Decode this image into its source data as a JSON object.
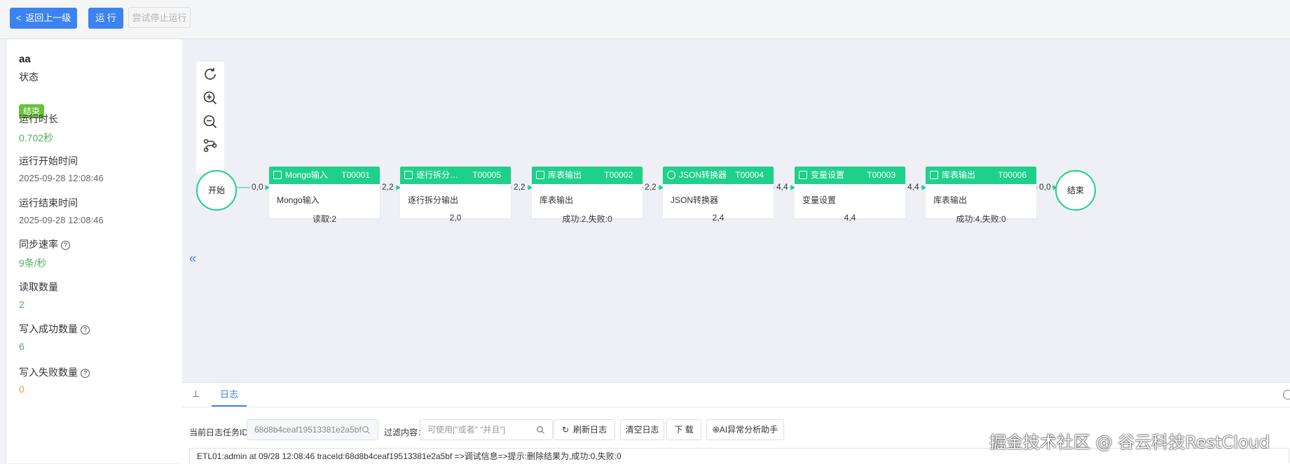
{
  "toolbar": {
    "back_label": "返回上一级",
    "run_label": "运 行",
    "stop_label": "尝试停止运行"
  },
  "summary": {
    "title": "aa",
    "status_label": "状态",
    "status_value": "结束",
    "duration_label": "运行时长",
    "duration_value": "0.702秒",
    "start_label": "运行开始时间",
    "start_value": "2025-09-28 12:08:46",
    "end_label": "运行结束时间",
    "end_value": "2025-09-28 12:08:46",
    "speed_label": "同步速率",
    "speed_value": "9条/秒",
    "read_label": "读取数量",
    "read_value": "2",
    "write_ok_label": "写入成功数量",
    "write_ok_value": "6",
    "write_fail_label": "写入失败数量",
    "write_fail_value": "0"
  },
  "flow": {
    "start_label": "开始",
    "end_label": "结束",
    "nodes": [
      {
        "title": "Mongo输入",
        "code": "T00001",
        "body": "Mongo输入",
        "stat": "读取:2"
      },
      {
        "title": "逐行拆分…",
        "code": "T00005",
        "body": "逐行拆分输出",
        "stat": "2,0"
      },
      {
        "title": "库表输出",
        "code": "T00002",
        "body": "库表输出",
        "stat": "成功:2,失败:0"
      },
      {
        "title": "JSON转换器",
        "code": "T00004",
        "body": "JSON转换器",
        "stat": "2,4"
      },
      {
        "title": "变量设置",
        "code": "T00003",
        "body": "变量设置",
        "stat": "4,4"
      },
      {
        "title": "库表输出",
        "code": "T00006",
        "body": "库表输出",
        "stat": "成功:4,失败:0"
      }
    ],
    "edges": [
      "0,0",
      "2,2",
      "2,2",
      "2,2",
      "4,4",
      "4,4",
      "0,0"
    ]
  },
  "log": {
    "tab_label": "日志",
    "task_id_label": "当前日志任务ID：",
    "task_id_value": "68d8b4ceaf19513381e2a5bf",
    "filter_label": "过滤内容：",
    "filter_placeholder": "可使用[\"或者\" \"并且\"]",
    "refresh_label": "刷新日志",
    "clear_label": "清空日志",
    "download_label": "下 载",
    "ai_label": "AI异常分析助手",
    "line": "ETL01:admin at 09/28 12:08:46 traceId:68d8b4ceaf19513381e2a5bf =>调试信息=>提示:删除结果为,成功:0,失败:0"
  },
  "watermark": "掘金技术社区 @ 谷云科技RestCloud",
  "colors": {
    "primary": "#3c82f0",
    "node_green": "#1fd08a",
    "status_green": "#67c23a"
  }
}
